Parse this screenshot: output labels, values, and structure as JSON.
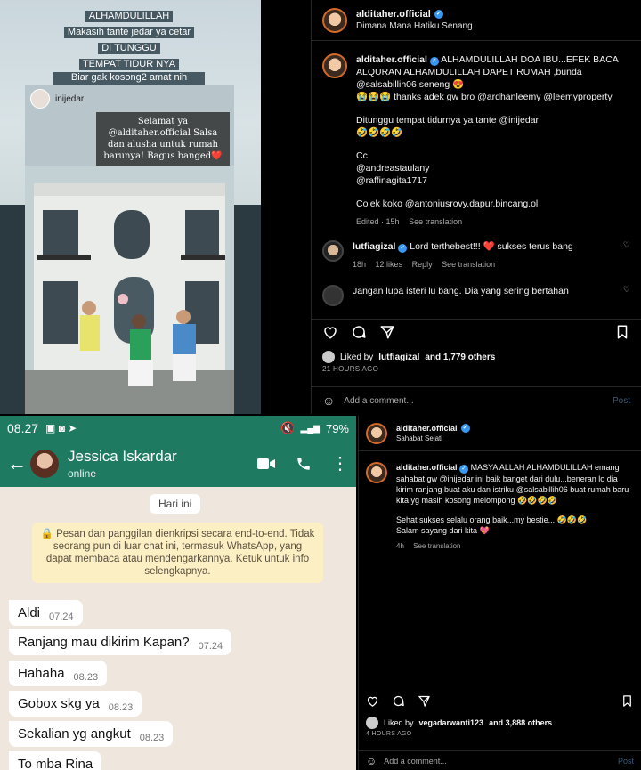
{
  "story": {
    "caption_lines": [
      "ALHAMDULILLAH",
      "Makasih tante jedar ya cetar",
      "DI TUNGGU",
      "TEMPAT TIDUR NYA",
      "Biar gak kosong2 amat nih rumah"
    ],
    "caption_emoji": "🤣🤣🤣🤣🤣🤣",
    "tag_username": "inijedar",
    "quote": "Selamat ya @alditaher.official Salsa dan alusha untuk rumah barunya! Bagus banged❤️"
  },
  "ig_post_1": {
    "username": "alditaher.official",
    "header_subtitle": "Dimana Mana Hatiku Senang",
    "caption_username": "alditaher.official",
    "caption_lines": [
      "ALHAMDULILLAH DOA IBU...EFEK BACA ALQURAN ALHAMDULILLAH DAPET RUMAH ,bunda @salsabillih06 seneng 😍",
      "😭😭😭 thanks adek gw bro @ardhanleemy @leemyproperty",
      "",
      "Ditunggu tempat tidurnya ya tante @inijedar",
      "🤣🤣🤣🤣",
      "",
      "Cc",
      "@andreastaulany",
      "@raffinagita1717",
      "",
      "Colek koko @antoniusrovy.dapur.bincang.ol"
    ],
    "caption_meta_edited": "Edited · 15h",
    "caption_meta_translation": "See translation",
    "comment_username": "lutfiagizal",
    "comment_text": "Lord terthebest!!! ❤️ sukses terus bang",
    "comment_time": "18h",
    "comment_likes": "12 likes",
    "comment_reply": "Reply",
    "comment_translation": "See translation",
    "comment2_text": "Jangan lupa isteri lu bang. Dia yang sering bertahan",
    "liked_by_prefix": "Liked by",
    "liked_by_user": "lutfiagizal",
    "liked_by_suffix": "and 1,779 others",
    "timestamp": "21 HOURS AGO",
    "add_comment_placeholder": "Add a comment...",
    "post_label": "Post"
  },
  "whatsapp": {
    "status_time": "08.27",
    "battery": "79%",
    "contact_name": "Jessica Iskardar",
    "contact_status": "online",
    "day_chip": "Hari ini",
    "encryption_notice": "🔒 Pesan dan panggilan dienkripsi secara end-to-end. Tidak seorang pun di luar chat ini, termasuk WhatsApp, yang dapat membaca atau mendengarkannya. Ketuk untuk info selengkapnya.",
    "messages": [
      {
        "text": "Aldi",
        "time": "07.24"
      },
      {
        "text": "Ranjang mau dikirim Kapan?",
        "time": "07.24"
      },
      {
        "text": "Hahaha",
        "time": "08.23"
      },
      {
        "text": "Gobox skg ya",
        "time": "08.23"
      },
      {
        "text": "Sekalian yg angkut",
        "time": "08.23"
      },
      {
        "text": "To mba Rina",
        "time": ""
      }
    ]
  },
  "ig_post_2": {
    "username": "alditaher.official",
    "header_subtitle": "Sahabat Sejati",
    "caption_username": "alditaher.official",
    "caption_lines": [
      "MASYA ALLAH ALHAMDULILLAH emang sahabat gw @inijedar ini baik banget dari dulu...beneran lo dia kirim ranjang buat aku dan istriku @salsabillih06 buat rumah baru kita yg masih kosong melompong 🤣🤣🤣🤣",
      "",
      "Sehat sukses selalu orang baik...my bestie... 🤣🤣🤣",
      "Salam sayang dari kita 💖"
    ],
    "caption_meta_time": "4h",
    "caption_meta_translation": "See translation",
    "liked_by_prefix": "Liked by",
    "liked_by_user": "vegadarwanti123",
    "liked_by_suffix": "and 3,888 others",
    "timestamp": "4 HOURS AGO",
    "add_comment_placeholder": "Add a comment...",
    "post_label": "Post"
  },
  "colors": {
    "whatsapp_green": "#1f7a62",
    "instagram_bg": "#000000",
    "verified_blue": "#3897f0",
    "chat_bg": "#efe7de"
  }
}
